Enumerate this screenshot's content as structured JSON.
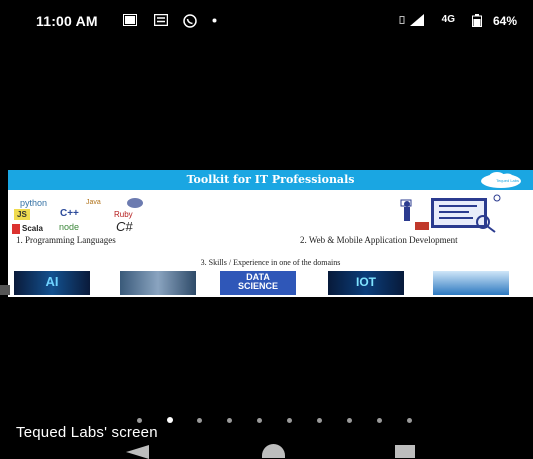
{
  "status_bar": {
    "time": "11:00 AM",
    "battery": "64%",
    "network": "4G",
    "left_icons": [
      "image-icon",
      "message-icon",
      "whatsapp-icon",
      "dot-icon"
    ],
    "right_icons": [
      "vibrate-icon",
      "signal-icon",
      "data-icon",
      "battery-icon"
    ]
  },
  "banner": {
    "title": "Toolkit for IT Professionals",
    "logo_text": "Tequed Labs",
    "languages": [
      "python",
      "JS",
      "Java",
      "C++",
      "Ruby",
      "Scala",
      "node",
      "C#"
    ],
    "caption_1": "1. Programming Languages",
    "caption_2": "2. Web & Mobile Application Development",
    "caption_3": "3. Skills / Experience in one of the domains",
    "domains": [
      "AI",
      "",
      "DATA SCIENCE",
      "IOT",
      ""
    ]
  },
  "pager": {
    "count": 10,
    "active_index": 1
  },
  "caption": "Tequed Labs' screen",
  "colors": {
    "banner_blue": "#1aa6e2",
    "background": "#000000"
  }
}
